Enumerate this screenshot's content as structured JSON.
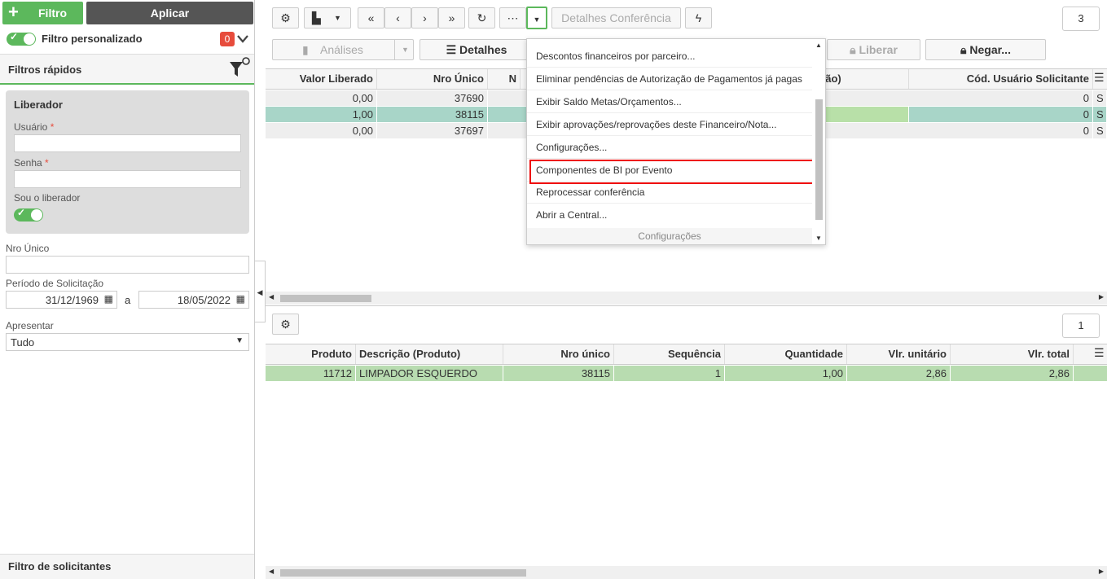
{
  "sidebar": {
    "filtro_label": "Filtro",
    "aplicar_label": "Aplicar",
    "custom_filter_label": "Filtro personalizado",
    "custom_filter_count": "0",
    "quick_filters_title": "Filtros rápidos",
    "liberador_title": "Liberador",
    "usuario_label": "Usuário",
    "senha_label": "Senha",
    "required_mark": "*",
    "sou_liberador_label": "Sou o liberador",
    "nro_unico_label": "Nro Único",
    "periodo_label": "Período de Solicitação",
    "date_from": "31/12/1969",
    "date_sep": "a",
    "date_to": "18/05/2022",
    "apresentar_label": "Apresentar",
    "apresentar_value": "Tudo",
    "solicitantes_title": "Filtro de solicitantes"
  },
  "toolbar": {
    "detalhes_conferencia": "Detalhes Conferência",
    "analises": "Análises",
    "detalhes": "Detalhes",
    "liberar": "Liberar",
    "negar": "Negar...",
    "page_top": "3",
    "page_bottom": "1"
  },
  "top_grid": {
    "headers": [
      "Valor Liberado",
      "Nro Único",
      "N",
      "ção)",
      "Cód. Usuário Solicitante"
    ],
    "rows": [
      {
        "valor": "0,00",
        "nro": "37690",
        "cod": "0",
        "s": "S"
      },
      {
        "valor": "1,00",
        "nro": "38115",
        "cod": "0",
        "s": "S"
      },
      {
        "valor": "0,00",
        "nro": "37697",
        "cod": "0",
        "s": "S"
      }
    ]
  },
  "bottom_grid": {
    "headers": [
      "Produto",
      "Descrição (Produto)",
      "Nro único",
      "Sequência",
      "Quantidade",
      "Vlr. unitário",
      "Vlr. total"
    ],
    "rows": [
      {
        "produto": "11712",
        "descricao": "LIMPADOR ESQUERDO",
        "nro": "38115",
        "seq": "1",
        "qtd": "1,00",
        "unit": "2,86",
        "total": "2,86"
      }
    ]
  },
  "menu": {
    "items": [
      "Descontos financeiros por parceiro...",
      "Eliminar pendências de Autorização de Pagamentos já pagas",
      "Exibir Saldo Metas/Orçamentos...",
      "Exibir aprovações/reprovações deste Financeiro/Nota...",
      "Configurações...",
      "Componentes de BI por Evento",
      "Reprocessar conferência",
      "Abrir a Central..."
    ],
    "footer": "Configurações"
  },
  "colors": {
    "accent_green": "#5cb85c",
    "row_selected": "#a8d5c8",
    "highlight_red": "#e00000"
  }
}
